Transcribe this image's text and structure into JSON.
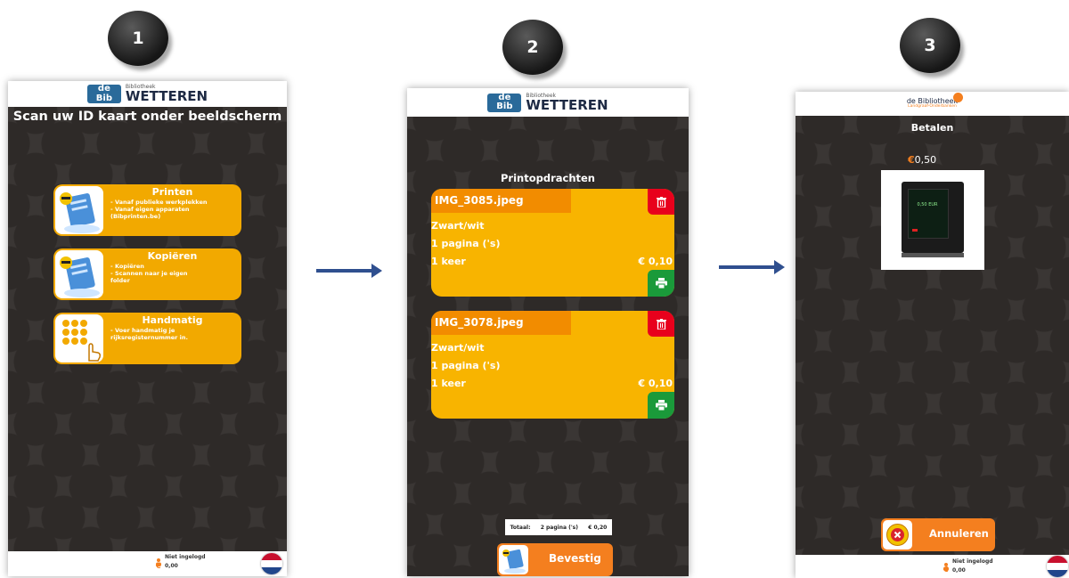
{
  "steps": [
    "1",
    "2",
    "3"
  ],
  "screen1": {
    "logo_small": "Bibliotheek",
    "logo_big": "WETTEREN",
    "logo_mark": "de Bib",
    "headline": "Scan uw ID kaart onder beeldscherm",
    "menu": [
      {
        "title": "Printen",
        "desc": "- Vanaf publieke werkplekken\n- Vanaf eigen apparaten\n(Bibprinten.be)"
      },
      {
        "title": "Kopiëren",
        "desc": "- Kopiëren\n- Scannen naar je eigen\nfolder"
      },
      {
        "title": "Handmatig",
        "desc": "- Voer handmatig je\nrijksregisternummer in."
      }
    ],
    "footer": {
      "user": "Niet ingelogd",
      "balance": "0,00"
    }
  },
  "screen2": {
    "logo_small": "Bibliotheek",
    "logo_big": "WETTEREN",
    "logo_mark": "de Bib",
    "title": "Printopdrachten",
    "jobs": [
      {
        "name": "IMG_3085.jpeg",
        "mode": "Zwart/wit",
        "pages": "1 pagina ('s)",
        "copies": "1 keer",
        "price": "€ 0,10"
      },
      {
        "name": "IMG_3078.jpeg",
        "mode": "Zwart/wit",
        "pages": "1 pagina ('s)",
        "copies": "1 keer",
        "price": "€ 0,10"
      }
    ],
    "total": {
      "label": "Totaal:",
      "pages": "2 pagina ('s)",
      "amount": "€ 0,20"
    },
    "confirm_label": "Bevestig"
  },
  "screen3": {
    "logo_text": "de Bibliotheek",
    "logo_sub": "Landgraaf-Onderbanken",
    "title": "Betalen",
    "amount_symbol": "€",
    "amount": "0,50",
    "terminal_display": "0,50 EUR",
    "cancel_label": "Annuleren",
    "footer": {
      "user": "Niet ingelogd",
      "balance": "0,00"
    }
  },
  "colors": {
    "accent_orange": "#f47f1f",
    "card_yellow": "#f8b400",
    "delete_red": "#e8001c",
    "print_green": "#1a9a3a"
  },
  "icons": [
    "person-icon",
    "euro-icon",
    "flag-nl-icon",
    "trash-icon",
    "printer-icon",
    "cancel-icon"
  ]
}
